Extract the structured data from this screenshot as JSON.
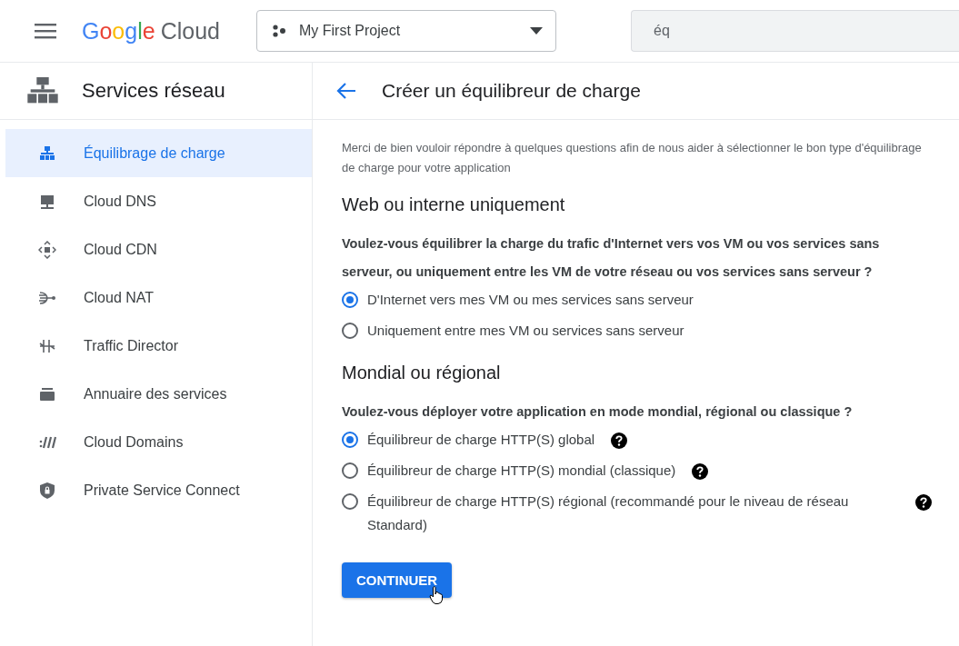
{
  "header": {
    "logo": {
      "brand": "Google",
      "product": "Cloud"
    },
    "project": "My First Project",
    "search": {
      "value": "éq"
    }
  },
  "sidebar": {
    "title": "Services réseau",
    "items": [
      {
        "label": "Équilibrage de charge",
        "selected": true
      },
      {
        "label": "Cloud DNS",
        "selected": false
      },
      {
        "label": "Cloud CDN",
        "selected": false
      },
      {
        "label": "Cloud NAT",
        "selected": false
      },
      {
        "label": "Traffic Director",
        "selected": false
      },
      {
        "label": "Annuaire des services",
        "selected": false
      },
      {
        "label": "Cloud Domains",
        "selected": false
      },
      {
        "label": "Private Service Connect",
        "selected": false
      }
    ]
  },
  "page": {
    "title": "Créer un équilibreur de charge",
    "intro": "Merci de bien vouloir répondre à quelques questions afin de nous aider à sélectionner le bon type d'équilibrage de charge pour votre application",
    "sections": [
      {
        "heading": "Web ou interne uniquement",
        "question": "Voulez-vous équilibrer la charge du trafic d'Internet vers vos VM ou vos services sans serveur, ou uniquement entre les VM de votre réseau ou vos services sans serveur ?",
        "options": [
          {
            "label": "D'Internet vers mes VM ou mes services sans serveur",
            "selected": true,
            "help": false
          },
          {
            "label": "Uniquement entre mes VM ou services sans serveur",
            "selected": false,
            "help": false
          }
        ]
      },
      {
        "heading": "Mondial ou régional",
        "question": "Voulez-vous déployer votre application en mode mondial, régional ou classique ?",
        "options": [
          {
            "label": "Équilibreur de charge HTTP(S) global",
            "selected": true,
            "help": true
          },
          {
            "label": "Équilibreur de charge HTTP(S) mondial (classique)",
            "selected": false,
            "help": true
          },
          {
            "label": "Équilibreur de charge HTTP(S) régional (recommandé pour le niveau de réseau Standard)",
            "selected": false,
            "help": true
          }
        ]
      }
    ],
    "button": "CONTINUER"
  }
}
